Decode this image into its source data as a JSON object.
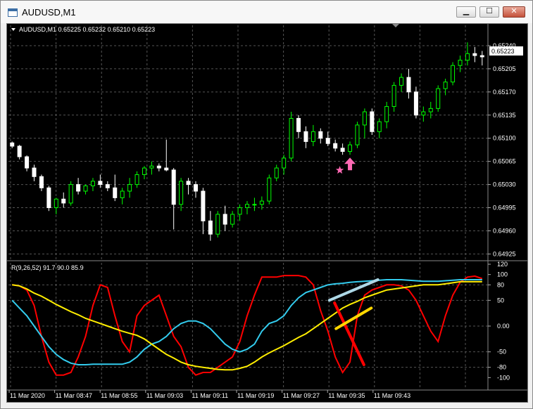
{
  "window": {
    "title": "AUDUSD,M1",
    "buttons": {
      "minimize": "▁",
      "maximize": "☐",
      "close": "✕"
    }
  },
  "price_panel": {
    "header": "AUDUSD,M1  0.65225 0.65232 0.65210 0.65223",
    "current_price": "0.65223",
    "y_ticks": [
      "0.65240",
      "0.65205",
      "0.65170",
      "0.65135",
      "0.65100",
      "0.65065",
      "0.65030",
      "0.64995",
      "0.64960",
      "0.64925"
    ],
    "bull_color": "#00ff00",
    "bear_color": "#ffffff",
    "arrow_color": "#ff69b4",
    "star_color": "#ff69b4"
  },
  "indicator_panel": {
    "header": "R(9,26,52) 91.7 90.0 85.9",
    "y_ticks": [
      "120",
      "100",
      "80",
      "50",
      "0.00",
      "-50",
      "-80",
      "-100"
    ],
    "series_colors": [
      "#ff0000",
      "#33ccee",
      "#ffee00"
    ]
  },
  "x_ticks": [
    "11 Mar 2020",
    "11 Mar 08:47",
    "11 Mar 08:55",
    "11 Mar 09:03",
    "11 Mar 09:11",
    "11 Mar 09:19",
    "11 Mar 09:27",
    "11 Mar 09:35",
    "11 Mar 09:43"
  ],
  "chart_data": {
    "type": "candlestick",
    "symbol": "AUDUSD",
    "timeframe": "M1",
    "ohlc_last": {
      "open": 0.65225,
      "high": 0.65232,
      "low": 0.6521,
      "close": 0.65223
    },
    "ylim": [
      0.64918,
      0.65258
    ],
    "candles": [
      [
        0.65093,
        0.65095,
        0.65085,
        0.65088
      ],
      [
        0.65088,
        0.6509,
        0.65068,
        0.65072
      ],
      [
        0.65072,
        0.65074,
        0.6505,
        0.65055
      ],
      [
        0.65055,
        0.6506,
        0.65035,
        0.65042
      ],
      [
        0.65042,
        0.65045,
        0.6502,
        0.65025
      ],
      [
        0.65025,
        0.65028,
        0.6499,
        0.64995
      ],
      [
        0.64995,
        0.6501,
        0.64985,
        0.65008
      ],
      [
        0.65008,
        0.65018,
        0.64995,
        0.65002
      ],
      [
        0.65002,
        0.65035,
        0.64998,
        0.6503
      ],
      [
        0.6503,
        0.6504,
        0.65015,
        0.6502
      ],
      [
        0.6502,
        0.6503,
        0.65015,
        0.65028
      ],
      [
        0.65028,
        0.6504,
        0.6502,
        0.65035
      ],
      [
        0.65035,
        0.65045,
        0.65025,
        0.6503
      ],
      [
        0.6503,
        0.65035,
        0.6502,
        0.65025
      ],
      [
        0.65025,
        0.65045,
        0.65005,
        0.6501
      ],
      [
        0.6501,
        0.65025,
        0.65,
        0.6502
      ],
      [
        0.6502,
        0.6504,
        0.6501,
        0.6503
      ],
      [
        0.6503,
        0.6505,
        0.65025,
        0.65045
      ],
      [
        0.65045,
        0.65058,
        0.65038,
        0.65055
      ],
      [
        0.65055,
        0.65065,
        0.65045,
        0.65058
      ],
      [
        0.65058,
        0.65062,
        0.6505,
        0.65055
      ],
      [
        0.65055,
        0.65098,
        0.6505,
        0.65052
      ],
      [
        0.65052,
        0.65055,
        0.64962,
        0.65
      ],
      [
        0.65,
        0.6504,
        0.6499,
        0.65035
      ],
      [
        0.65035,
        0.6504,
        0.65015,
        0.6503
      ],
      [
        0.6503,
        0.65035,
        0.6501,
        0.6502
      ],
      [
        0.6502,
        0.65025,
        0.64955,
        0.64975
      ],
      [
        0.64975,
        0.6499,
        0.64945,
        0.64955
      ],
      [
        0.64955,
        0.6499,
        0.6495,
        0.64985
      ],
      [
        0.64985,
        0.64998,
        0.6496,
        0.6497
      ],
      [
        0.6497,
        0.6499,
        0.64965,
        0.64985
      ],
      [
        0.64985,
        0.65,
        0.64975,
        0.64995
      ],
      [
        0.64995,
        0.65005,
        0.64985,
        0.65
      ],
      [
        0.65,
        0.6501,
        0.6499,
        0.65
      ],
      [
        0.65,
        0.65012,
        0.64992,
        0.65005
      ],
      [
        0.65005,
        0.65045,
        0.65,
        0.6504
      ],
      [
        0.6504,
        0.6506,
        0.65035,
        0.65055
      ],
      [
        0.65055,
        0.65075,
        0.65045,
        0.6507
      ],
      [
        0.6507,
        0.6514,
        0.65065,
        0.6513
      ],
      [
        0.6513,
        0.65135,
        0.651,
        0.6511
      ],
      [
        0.6511,
        0.65118,
        0.65085,
        0.65095
      ],
      [
        0.65095,
        0.6512,
        0.65088,
        0.6511
      ],
      [
        0.6511,
        0.65115,
        0.65092,
        0.651
      ],
      [
        0.651,
        0.6511,
        0.65088,
        0.65092
      ],
      [
        0.65092,
        0.65098,
        0.6508,
        0.65085
      ],
      [
        0.65085,
        0.65092,
        0.65075,
        0.6508
      ],
      [
        0.6508,
        0.65095,
        0.65075,
        0.6509
      ],
      [
        0.6509,
        0.65125,
        0.65085,
        0.6512
      ],
      [
        0.6512,
        0.65145,
        0.651,
        0.6514
      ],
      [
        0.6514,
        0.65145,
        0.65105,
        0.6511
      ],
      [
        0.6511,
        0.6513,
        0.651,
        0.65125
      ],
      [
        0.65125,
        0.65155,
        0.65115,
        0.65148
      ],
      [
        0.65148,
        0.65185,
        0.6514,
        0.6518
      ],
      [
        0.6518,
        0.65198,
        0.6517,
        0.65192
      ],
      [
        0.65192,
        0.65205,
        0.6516,
        0.6517
      ],
      [
        0.6517,
        0.65178,
        0.6513,
        0.65135
      ],
      [
        0.65135,
        0.65148,
        0.65125,
        0.6514
      ],
      [
        0.6514,
        0.65155,
        0.6513,
        0.65145
      ],
      [
        0.65145,
        0.6518,
        0.6514,
        0.65175
      ],
      [
        0.65175,
        0.6519,
        0.65165,
        0.65185
      ],
      [
        0.65185,
        0.65215,
        0.6518,
        0.6521
      ],
      [
        0.6521,
        0.65225,
        0.652,
        0.65218
      ],
      [
        0.65218,
        0.65245,
        0.6521,
        0.65228
      ],
      [
        0.65228,
        0.65238,
        0.65215,
        0.65225
      ],
      [
        0.65225,
        0.65232,
        0.6521,
        0.65223
      ]
    ],
    "signal_arrow": {
      "type": "up",
      "candle_index": 46
    },
    "signal_star": {
      "candle_index": 45
    },
    "indicator": {
      "name": "R(9,26,52)",
      "ylim": [
        -120,
        120
      ],
      "series": [
        {
          "name": "R9",
          "color": "#ff0000",
          "values": [
            80,
            78,
            70,
            40,
            -20,
            -70,
            -95,
            -95,
            -90,
            -60,
            -20,
            40,
            80,
            75,
            20,
            -30,
            -50,
            20,
            40,
            50,
            60,
            20,
            -20,
            -40,
            -80,
            -95,
            -90,
            -90,
            -80,
            -70,
            -60,
            -30,
            20,
            60,
            95,
            95,
            95,
            98,
            98,
            98,
            95,
            80,
            30,
            -10,
            -60,
            -90,
            -70,
            20,
            60,
            70,
            75,
            80,
            80,
            78,
            70,
            50,
            20,
            -10,
            -30,
            20,
            60,
            85,
            95,
            97,
            92
          ]
        },
        {
          "name": "R26",
          "color": "#33ccee",
          "values": [
            50,
            35,
            20,
            0,
            -20,
            -40,
            -55,
            -65,
            -72,
            -75,
            -75,
            -74,
            -74,
            -74,
            -74,
            -74,
            -70,
            -60,
            -45,
            -35,
            -30,
            -20,
            -5,
            5,
            10,
            10,
            5,
            -5,
            -20,
            -35,
            -45,
            -50,
            -45,
            -35,
            -10,
            5,
            10,
            20,
            40,
            55,
            65,
            70,
            75,
            80,
            82,
            83,
            85,
            86,
            87,
            88,
            89,
            90,
            90,
            90,
            89,
            88,
            87,
            87,
            87,
            88,
            89,
            90,
            90,
            90,
            90
          ]
        },
        {
          "name": "R52",
          "color": "#ffee00",
          "values": [
            80,
            78,
            72,
            64,
            58,
            50,
            42,
            35,
            28,
            22,
            15,
            10,
            5,
            0,
            -5,
            -10,
            -14,
            -18,
            -25,
            -35,
            -45,
            -55,
            -62,
            -70,
            -75,
            -78,
            -80,
            -82,
            -84,
            -85,
            -85,
            -82,
            -78,
            -70,
            -60,
            -52,
            -45,
            -38,
            -30,
            -22,
            -15,
            -5,
            5,
            15,
            25,
            35,
            42,
            48,
            55,
            60,
            65,
            70,
            72,
            74,
            76,
            78,
            80,
            80,
            80,
            82,
            84,
            86,
            86,
            86,
            86
          ]
        }
      ],
      "annotations": [
        {
          "color": "#add8e6",
          "from": [
            43.7,
            50
          ],
          "to": [
            50.3,
            90
          ]
        },
        {
          "color": "#ff0000",
          "from": [
            44.4,
            45
          ],
          "to": [
            48.4,
            -75
          ]
        },
        {
          "color": "#ffd700",
          "from": [
            44.6,
            -5
          ],
          "to": [
            49.4,
            35
          ]
        }
      ]
    }
  }
}
